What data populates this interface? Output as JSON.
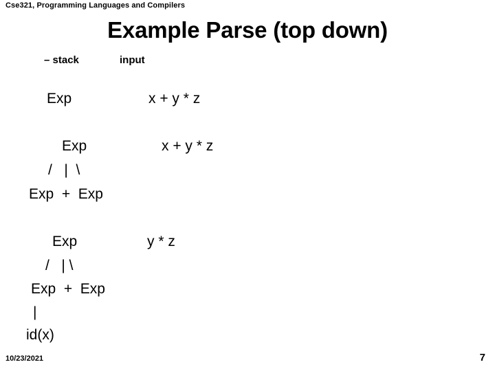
{
  "slide": {
    "header": "Cse321, Programming Languages and Compilers",
    "title": "Example Parse (top down)",
    "background_color": "#ffffff",
    "text_color": "#000000"
  },
  "legend": {
    "stack_label": "–  stack",
    "input_label": "input"
  },
  "stages": [
    {
      "name": "stage-1",
      "stack_root": "Exp",
      "input": "x + y * z",
      "branches": null,
      "children": null,
      "stem": null,
      "leaf": null
    },
    {
      "name": "stage-2",
      "stack_root": "Exp",
      "input": "x + y * z",
      "branches": "/   |  \\",
      "children": "Exp  +  Exp",
      "stem": null,
      "leaf": null
    },
    {
      "name": "stage-3",
      "stack_root": "Exp",
      "input": "y * z",
      "branches": "/   | \\",
      "children": "Exp  +  Exp",
      "stem": "|",
      "leaf": "id(x)"
    }
  ],
  "footer": {
    "date": "10/23/2021",
    "page_number": "7"
  }
}
